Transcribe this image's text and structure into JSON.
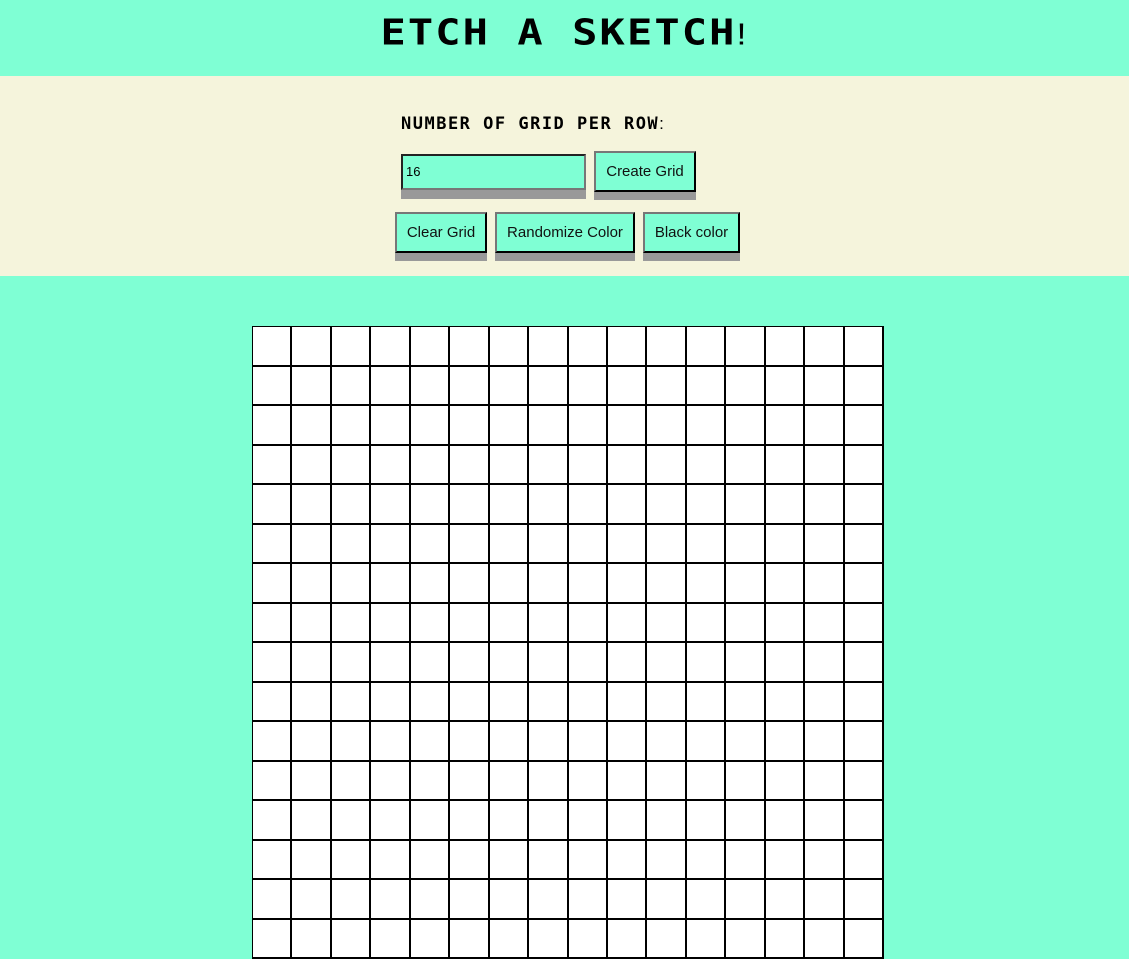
{
  "header": {
    "title": "ETCH A SKETCH",
    "title_suffix": "!"
  },
  "controls": {
    "label": "NUMBER OF GRID PER ROW",
    "label_suffix": ":",
    "grid_size_value": "16",
    "create_button": "Create Grid",
    "clear_button": "Clear Grid",
    "randomize_button": "Randomize Color",
    "black_button": "Black color"
  },
  "grid": {
    "cells_per_row": 16
  },
  "colors": {
    "background": "#7fffd4",
    "panel": "#f5f4dc",
    "cell": "#ffffff"
  }
}
